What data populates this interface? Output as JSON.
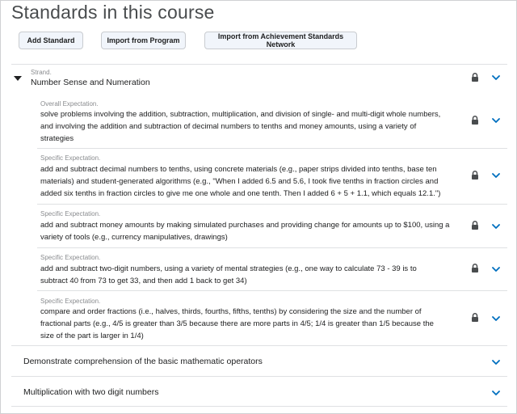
{
  "page": {
    "title": "Standards in this course"
  },
  "toolbar": {
    "add_standard": "Add Standard",
    "import_program": "Import from Program",
    "import_asn": "Import from Achievement Standards Network"
  },
  "strand": {
    "caption": "Strand.",
    "title": "Number Sense and Numeration"
  },
  "overall": {
    "caption": "Overall Expectation.",
    "lines": [
      "solve problems involving the addition, subtraction, multiplication, and division of single- and multi-digit whole numbers,",
      "and involving the addition and subtraction of decimal numbers to tenths and money amounts, using a variety of",
      "strategies"
    ]
  },
  "specific": [
    {
      "caption": "Specific Expectation.",
      "lines": [
        "add and subtract decimal numbers to tenths, using concrete materials (e.g., paper strips divided into tenths, base ten",
        "materials) and student-generated algorithms (e.g., \"When I added 6.5 and 5.6, I took five tenths in fraction circles and",
        "added six tenths in fraction circles to give me one whole and one tenth. Then I added 6 + 5 + 1.1, which equals 12.1.\")"
      ]
    },
    {
      "caption": "Specific Expectation.",
      "lines": [
        "add and subtract money amounts by making simulated purchases and providing change for amounts up to $100, using a",
        "variety of tools (e.g., currency manipulatives, drawings)"
      ]
    },
    {
      "caption": "Specific Expectation.",
      "lines": [
        "add and subtract two-digit numbers, using a variety of mental strategies (e.g., one way to calculate 73 - 39 is to",
        "subtract 40 from 73 to get 33, and then add 1 back to get 34)"
      ]
    },
    {
      "caption": "Specific Expectation.",
      "lines": [
        "compare and order fractions (i.e., halves, thirds, fourths, fifths, tenths) by considering the size and the number of",
        "fractional parts (e.g., 4/5 is greater than 3/5 because there are more parts in 4/5; 1/4 is greater than 1/5 because the",
        "size of the part is larger in 1/4)"
      ]
    }
  ],
  "other_rows": [
    {
      "title": "Demonstrate comprehension of the basic mathematic operators"
    },
    {
      "title": "Multiplication with two digit numbers"
    }
  ],
  "icons": {
    "lock": "lock-icon",
    "expand": "chevron-down-icon",
    "collapse": "caret-down-icon"
  },
  "colors": {
    "accent": "#006fbf",
    "text": "#202122",
    "caption": "#8a8c8f"
  }
}
